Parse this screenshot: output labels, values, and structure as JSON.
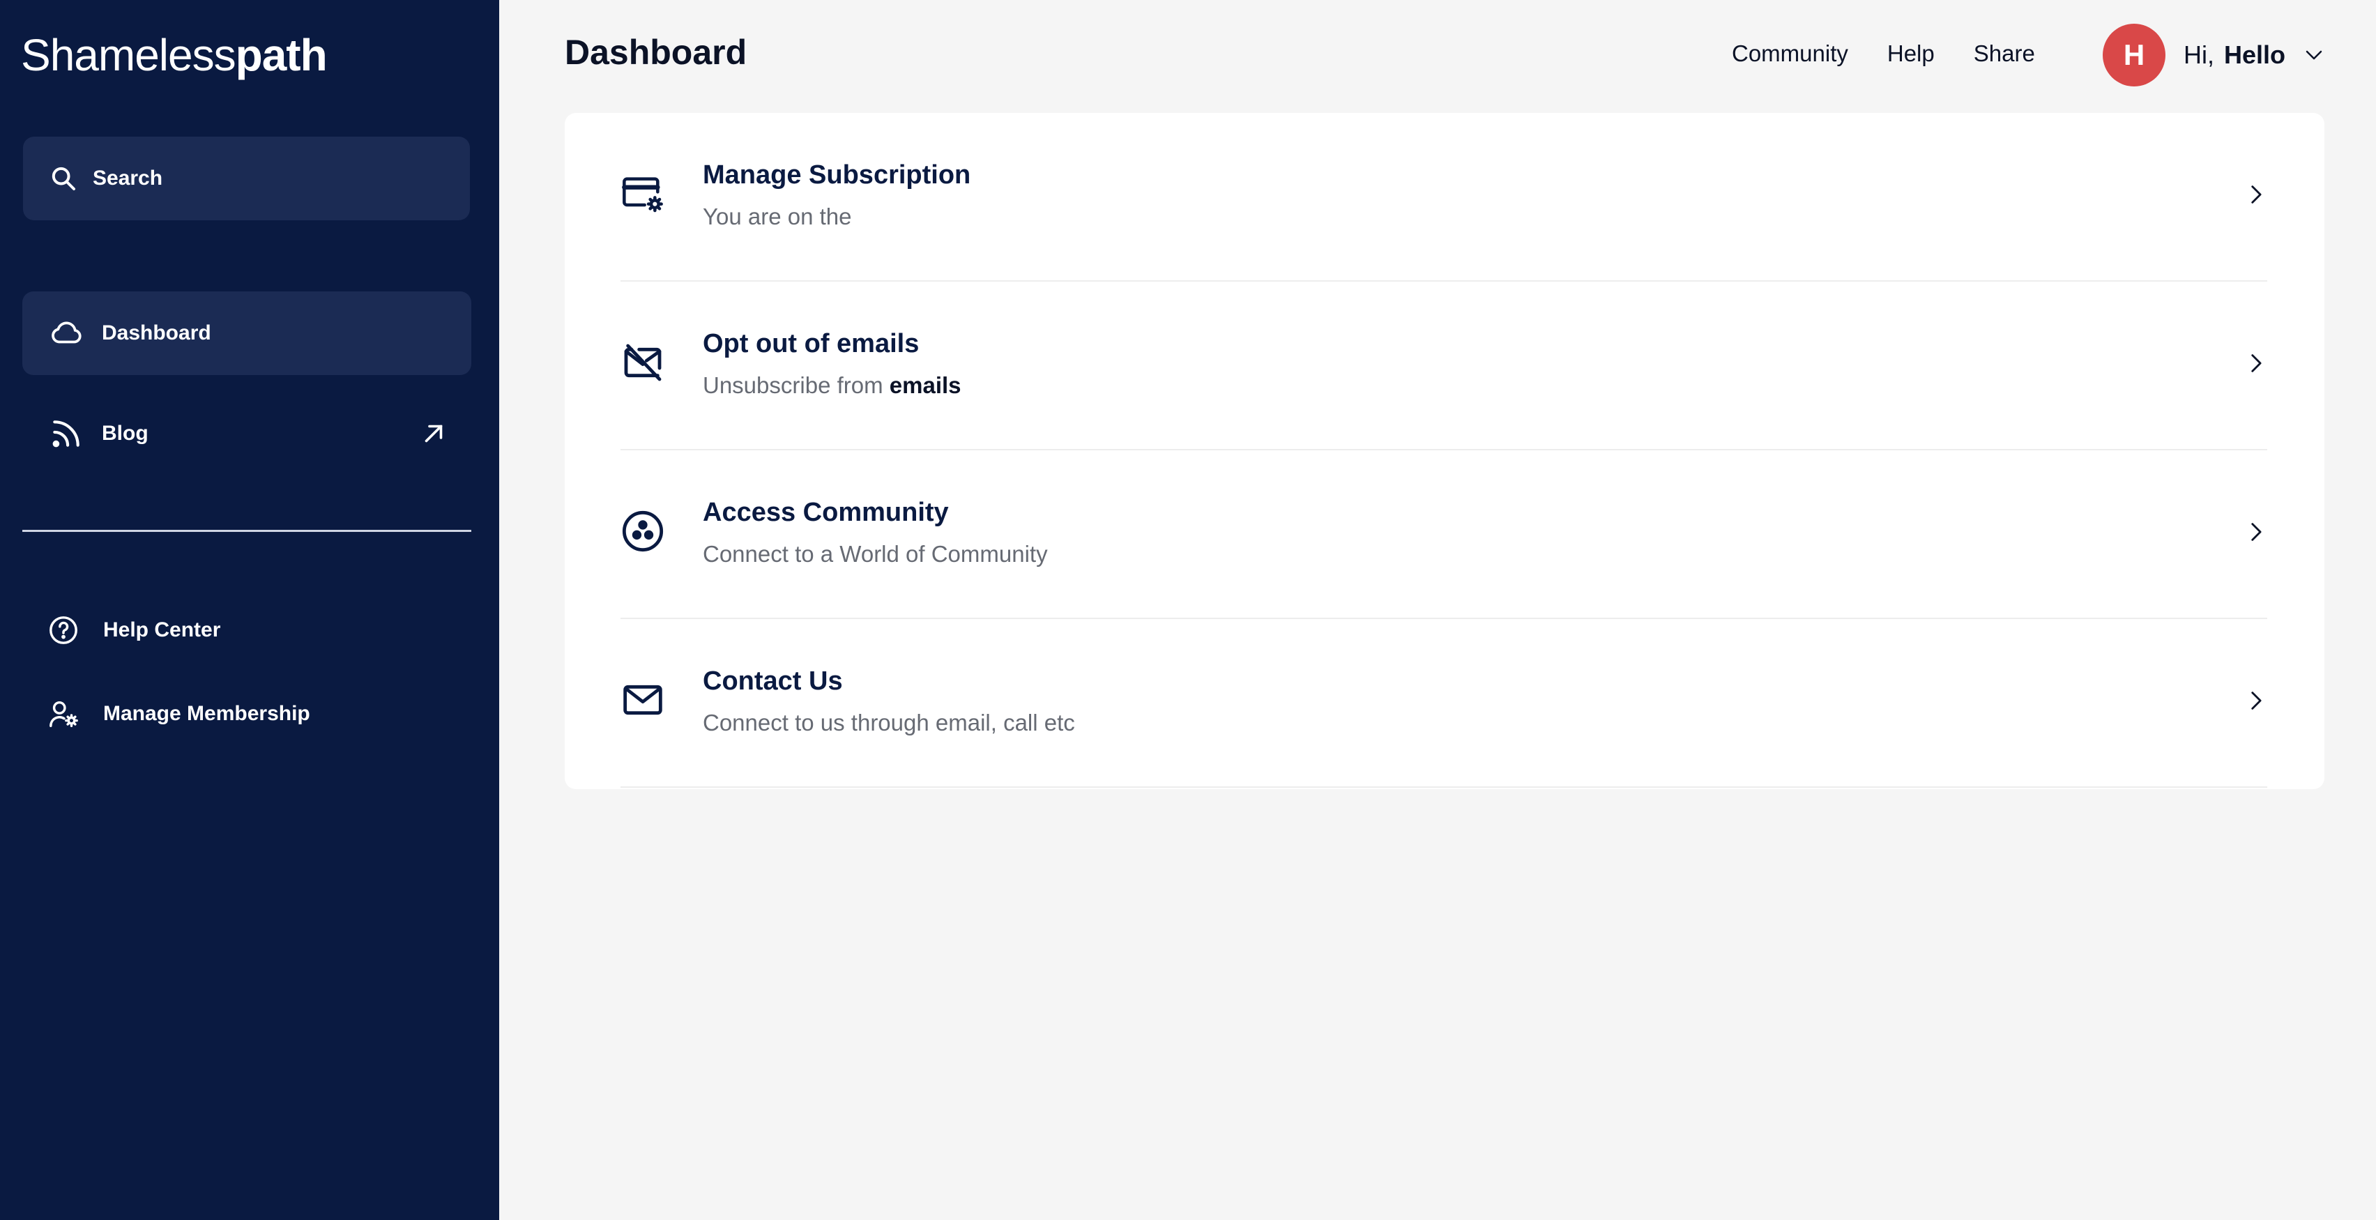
{
  "app": {
    "logo_light": "Shameless",
    "logo_bold": "path"
  },
  "sidebar": {
    "search_label": "Search",
    "items": [
      {
        "label": "Dashboard",
        "icon": "cloud-icon",
        "active": true
      },
      {
        "label": "Blog",
        "icon": "rss-icon",
        "external": true
      }
    ],
    "secondary_items": [
      {
        "label": "Help Center",
        "icon": "help-circle-icon"
      },
      {
        "label": "Manage Membership",
        "icon": "user-gear-icon"
      }
    ]
  },
  "header": {
    "title": "Dashboard",
    "links": [
      "Community",
      "Help",
      "Share"
    ],
    "user": {
      "initial": "H",
      "greeting": "Hi,",
      "name": "Hello"
    }
  },
  "dashboard": {
    "rows": [
      {
        "title": "Manage Subscription",
        "subtitle": "You are on the",
        "subtitle_bold": "",
        "icon": "credit-card-gear-icon"
      },
      {
        "title": "Opt out of emails",
        "subtitle": "Unsubscribe from ",
        "subtitle_bold": "emails",
        "icon": "mail-off-icon"
      },
      {
        "title": "Access Community",
        "subtitle": "Connect to a World of Community",
        "subtitle_bold": "",
        "icon": "community-icon"
      },
      {
        "title": "Contact Us",
        "subtitle": "Connect to us through email, call etc",
        "subtitle_bold": "",
        "icon": "mail-icon"
      }
    ]
  },
  "colors": {
    "sidebar_bg": "#0a1a41",
    "sidebar_active": "#1b2b54",
    "avatar": "#d94848",
    "page_bg": "#f5f5f5"
  }
}
